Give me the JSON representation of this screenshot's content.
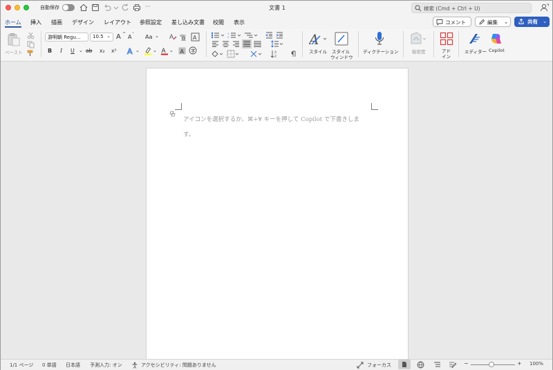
{
  "titlebar": {
    "autosave_label": "自動保存",
    "document_title": "文書 1",
    "search_placeholder": "検索 (Cmd + Ctrl + U)",
    "more_label": "···"
  },
  "tabs": [
    {
      "label": "ホーム",
      "active": true
    },
    {
      "label": "挿入"
    },
    {
      "label": "描画"
    },
    {
      "label": "デザイン"
    },
    {
      "label": "レイアウト"
    },
    {
      "label": "参照設定"
    },
    {
      "label": "差し込み文書"
    },
    {
      "label": "校閲"
    },
    {
      "label": "表示"
    }
  ],
  "actions": {
    "comment_label": "コメント",
    "edit_label": "編集",
    "share_label": "共有"
  },
  "ribbon": {
    "paste_label": "ペースト",
    "font_name": "游明朝 Regu...",
    "font_size": "10.5",
    "styles_label": "スタイル",
    "styles_window_label": "スタイル\nウィンドウ",
    "styles_window_line1": "スタイル",
    "styles_window_line2": "ウィンドウ",
    "dictation_label": "ディクテーション",
    "sensitivity_label": "秘密度",
    "addin_line1": "アド",
    "addin_line2": "イン",
    "editor_label": "エディター",
    "copilot_label": "Copilot",
    "bold": "B",
    "italic": "I",
    "underline": "U",
    "strike": "ab",
    "subscript": "x₂",
    "superscript": "x²",
    "grow_font": "A",
    "shrink_font": "A",
    "change_case": "Aa",
    "clear_format": "A"
  },
  "document": {
    "placeholder_line1": "アイコンを選択するか、⌘+¥ キーを押して Copilot で下書きしま",
    "placeholder_line2": "す。"
  },
  "statusbar": {
    "page": "1/1 ページ",
    "words": "0 単語",
    "language": "日本語",
    "predictive": "予測入力: オン",
    "accessibility": "アクセシビリティ: 問題ありません",
    "focus": "フォーカス",
    "zoom_minus": "−",
    "zoom_plus": "+",
    "zoom": "100%"
  },
  "colors": {
    "accent": "#2b579a",
    "share_button": "#2f5fbf",
    "highlight": "#ffff00",
    "font_color": "#e02020"
  }
}
